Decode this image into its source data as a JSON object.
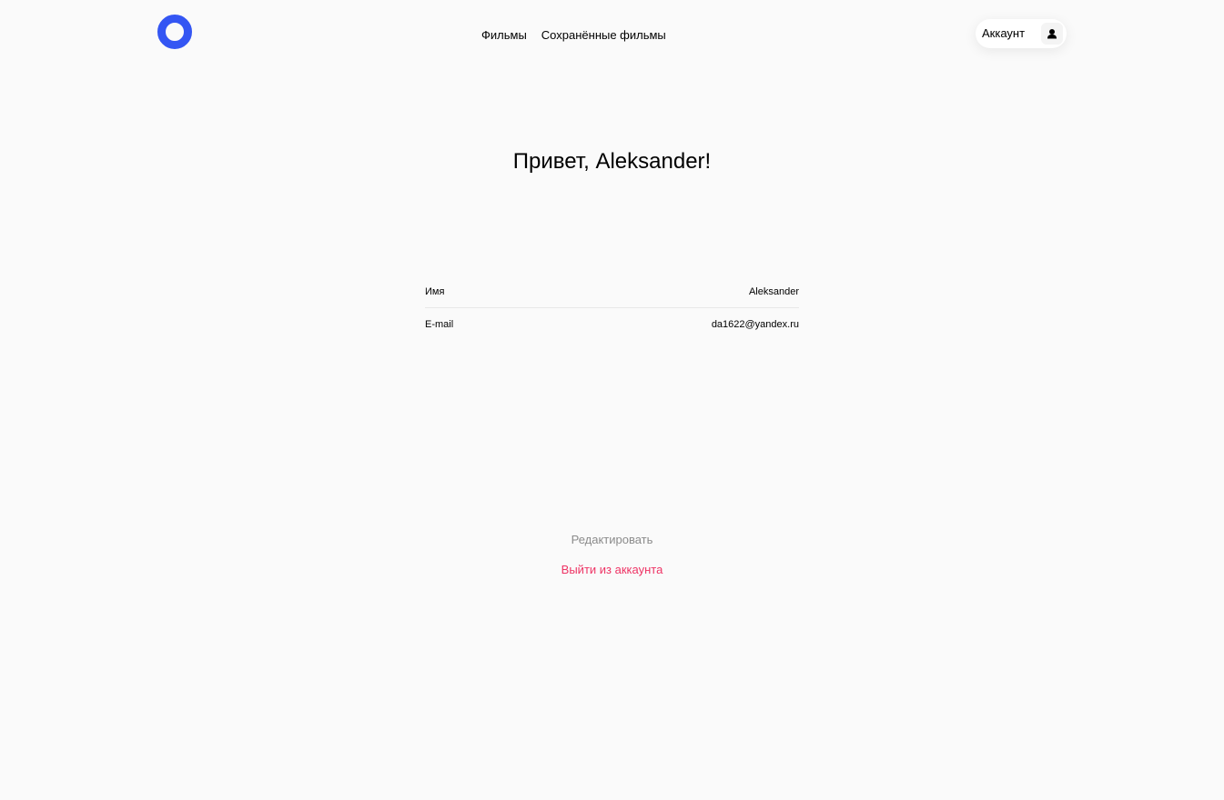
{
  "header": {
    "nav": {
      "movies": "Фильмы",
      "saved_movies": "Сохранённые фильмы"
    },
    "account_label": "Аккаунт",
    "account_icon": "user-icon"
  },
  "profile": {
    "greeting": "Привет, Aleksander!",
    "fields": [
      {
        "label": "Имя",
        "value": "Aleksander"
      },
      {
        "label": "E-mail",
        "value": "da1622@yandex.ru"
      }
    ],
    "edit_label": "Редактировать",
    "logout_label": "Выйти из аккаунта"
  },
  "colors": {
    "brand": "#3456f3",
    "logout": "#ee3465",
    "muted": "#8b8b8b",
    "background": "#fafafa"
  }
}
